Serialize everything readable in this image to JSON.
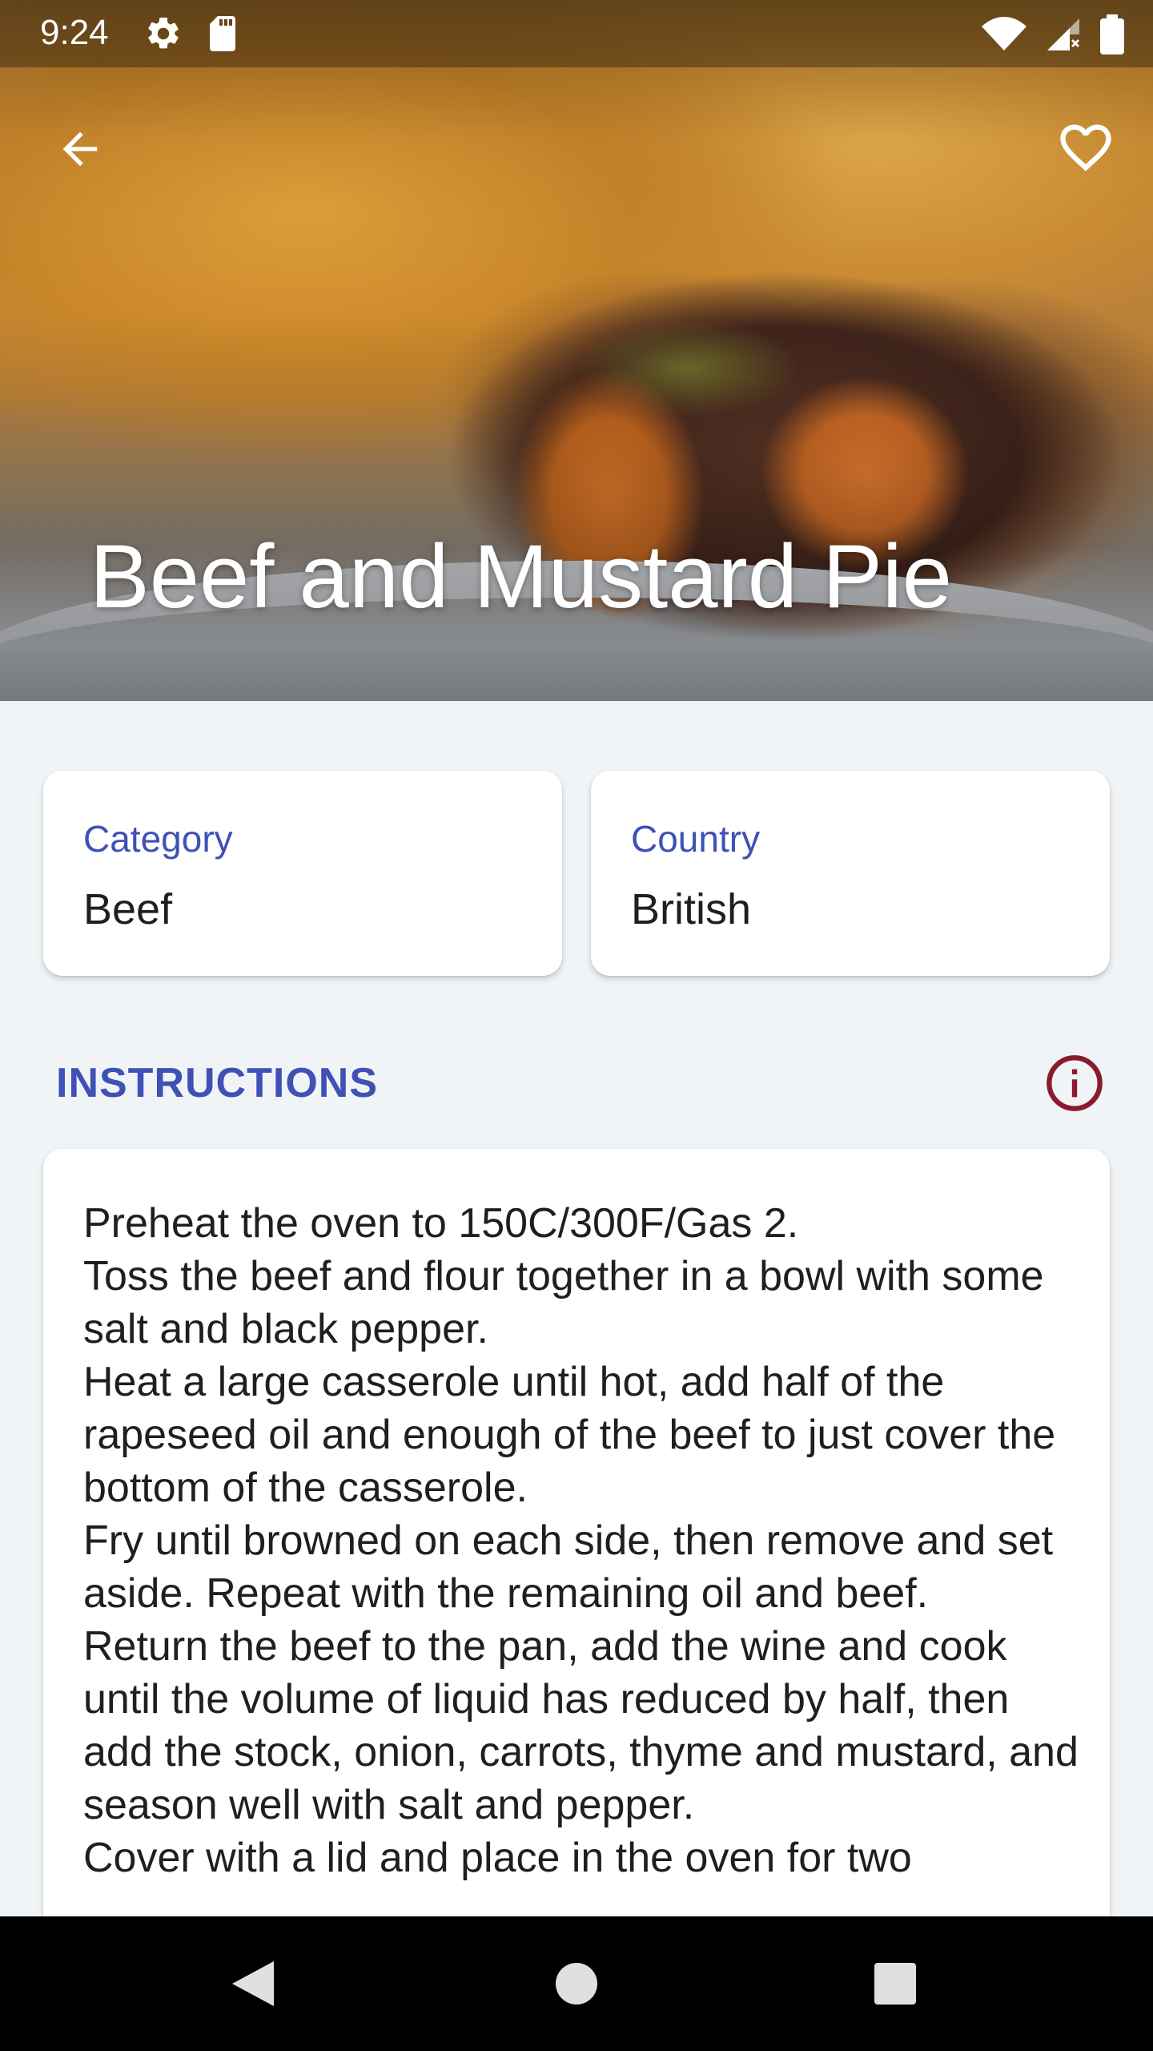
{
  "status_bar": {
    "time": "9:24",
    "icons": [
      "settings-icon",
      "sd-card-icon",
      "wifi-icon",
      "cellular-no-data-icon",
      "battery-icon"
    ]
  },
  "toolbar": {
    "back_icon": "arrow-back-icon",
    "favorite_icon": "heart-outline-icon"
  },
  "recipe": {
    "title": "Beef and Mustard Pie"
  },
  "cards": {
    "category": {
      "label": "Category",
      "value": "Beef"
    },
    "country": {
      "label": "Country",
      "value": "British"
    }
  },
  "instructions": {
    "heading": "INSTRUCTIONS",
    "info_icon": "info-icon",
    "info_icon_color": "#8b1a2e",
    "text": "Preheat the oven to 150C/300F/Gas 2.\nToss the beef and flour together in a bowl with some salt and black pepper.\nHeat a large casserole until hot, add half of the rapeseed oil and enough of the beef to just cover the bottom of the casserole.\nFry until browned on each side, then remove and set aside. Repeat with the remaining oil and beef.\nReturn the beef to the pan, add the wine and cook until the volume of liquid has reduced by half, then add the stock, onion, carrots, thyme and mustard, and season well with salt and pepper.\nCover with a lid and place in the oven for two"
  },
  "navigation": {
    "icons": [
      "nav-back-icon",
      "nav-home-icon",
      "nav-recents-icon"
    ]
  },
  "colors": {
    "accent": "#3f51b5",
    "background": "#f1f4f6",
    "card": "#ffffff",
    "text": "#1f1f1f"
  }
}
